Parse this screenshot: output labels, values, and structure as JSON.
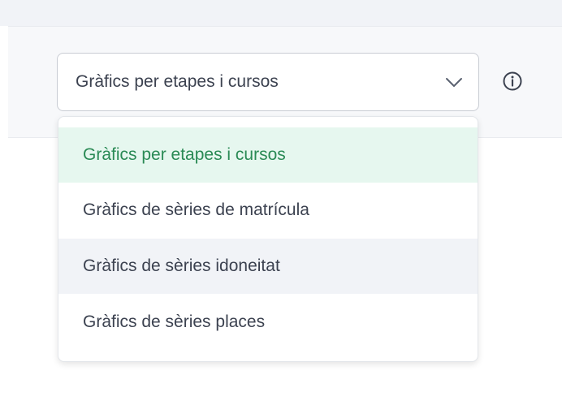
{
  "select": {
    "value": "Gràfics per etapes i cursos",
    "icon": "chevron-down-icon"
  },
  "info": {
    "icon": "info-circle-icon"
  },
  "dropdown": {
    "options": [
      {
        "label": "Gràfics per etapes i cursos",
        "state": "selected"
      },
      {
        "label": "Gràfics de sèries de matrícula",
        "state": "default"
      },
      {
        "label": "Gràfics de sèries idoneitat",
        "state": "hover"
      },
      {
        "label": "Gràfics de sèries places",
        "state": "default"
      }
    ]
  },
  "colors": {
    "selected_bg": "#e6f7ef",
    "selected_text": "#2a8a55",
    "hover_bg": "#f1f3f7",
    "text": "#3c4250"
  }
}
